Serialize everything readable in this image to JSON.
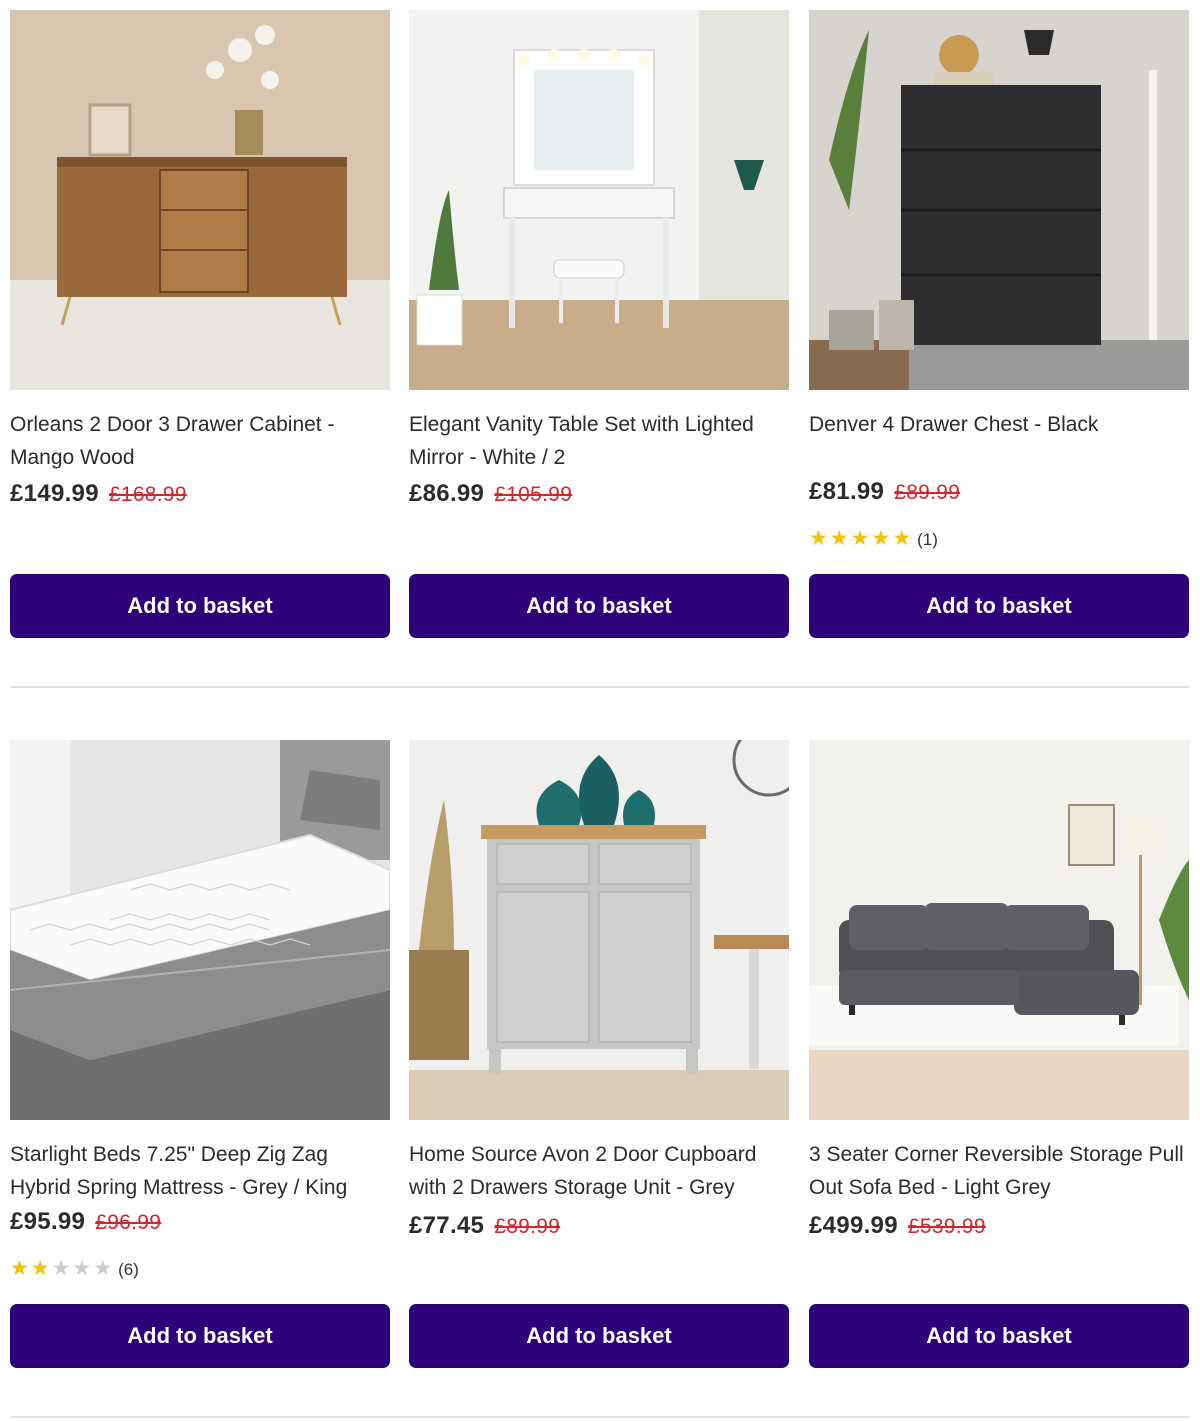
{
  "products": [
    {
      "title": "Orleans 2 Door 3 Drawer Cabinet - Mango Wood",
      "price": "£149.99",
      "was_price": "£168.99",
      "button_label": "Add to basket"
    },
    {
      "title": "Elegant Vanity Table Set with Lighted Mirror - White / 2",
      "price": "£86.99",
      "was_price": "£105.99",
      "button_label": "Add to basket"
    },
    {
      "title": "Denver 4 Drawer Chest - Black",
      "price": "£81.99",
      "was_price": "£89.99",
      "rating": 5,
      "rating_max": 5,
      "review_count": "(1)",
      "button_label": "Add to basket"
    },
    {
      "title": "Starlight Beds 7.25\" Deep Zig Zag Hybrid Spring Mattress - Grey / King",
      "price": "£95.99",
      "was_price": "£96.99",
      "rating": 2,
      "rating_max": 5,
      "review_count": "(6)",
      "button_label": "Add to basket"
    },
    {
      "title": "Home Source Avon 2 Door Cupboard with 2 Drawers Storage Unit - Grey",
      "price": "£77.45",
      "was_price": "£89.99",
      "button_label": "Add to basket"
    },
    {
      "title": "3 Seater Corner Reversible Storage Pull Out Sofa Bed - Light Grey",
      "price": "£499.99",
      "was_price": "£539.99",
      "button_label": "Add to basket"
    }
  ],
  "colors": {
    "button_bg": "#2e0079",
    "button_text": "#ffffff",
    "was_price": "#d8232a",
    "star_on": "#f2c200",
    "star_off": "#c7ccd1",
    "divider": "#d6e2e3"
  },
  "icons": {
    "star": "star-icon"
  }
}
